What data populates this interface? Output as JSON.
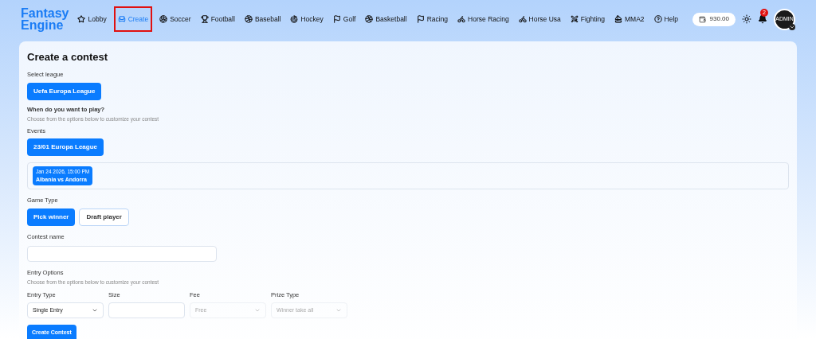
{
  "logo": [
    "Fantasy",
    "Engine"
  ],
  "nav": [
    {
      "label": "Lobby",
      "selected": false
    },
    {
      "label": "Create",
      "selected": true
    },
    {
      "label": "Soccer",
      "selected": false
    },
    {
      "label": "Football",
      "selected": false
    },
    {
      "label": "Baseball",
      "selected": false
    },
    {
      "label": "Hockey",
      "selected": false
    },
    {
      "label": "Golf",
      "selected": false
    },
    {
      "label": "Basketball",
      "selected": false
    },
    {
      "label": "Racing",
      "selected": false
    },
    {
      "label": "Horse Racing",
      "selected": false
    },
    {
      "label": "Horse Usa",
      "selected": false
    },
    {
      "label": "Fighting",
      "selected": false
    },
    {
      "label": "MMA2",
      "selected": false
    },
    {
      "label": "Help",
      "selected": false
    }
  ],
  "balance": "930.00",
  "notifications": "2",
  "avatar": "ADMIN",
  "title": "Create a contest",
  "league": {
    "label": "Select league",
    "options": [
      {
        "label": "Uefa Europa League",
        "selected": true
      }
    ]
  },
  "when": {
    "label": "When do you want to play?",
    "hint": "Choose from the options below to customize your contest"
  },
  "events": {
    "label": "Events",
    "options": [
      {
        "label": "23/01 Europa League",
        "selected": true
      }
    ]
  },
  "matches": [
    {
      "date": "Jan 24 2026, 15:00 PM",
      "teams": "Albania vs Andorra",
      "selected": true
    }
  ],
  "game_type": {
    "label": "Game Type",
    "options": [
      {
        "label": "Pick winner",
        "selected": true
      },
      {
        "label": "Draft player",
        "selected": false
      }
    ]
  },
  "contest_name": {
    "label": "Contest name"
  },
  "entry": {
    "label": "Entry Options",
    "hint": "Choose from the options below to customize your contest"
  },
  "fields": [
    {
      "kind": "select",
      "label": "Entry Type",
      "value": "Single Entry",
      "disabled": false
    },
    {
      "kind": "input",
      "label": "Size"
    },
    {
      "kind": "select",
      "label": "Fee",
      "value": "Free",
      "disabled": true
    },
    {
      "kind": "select",
      "label": "Prize Type",
      "value": "Winner take all",
      "disabled": true
    }
  ],
  "submit": "Create Contest"
}
